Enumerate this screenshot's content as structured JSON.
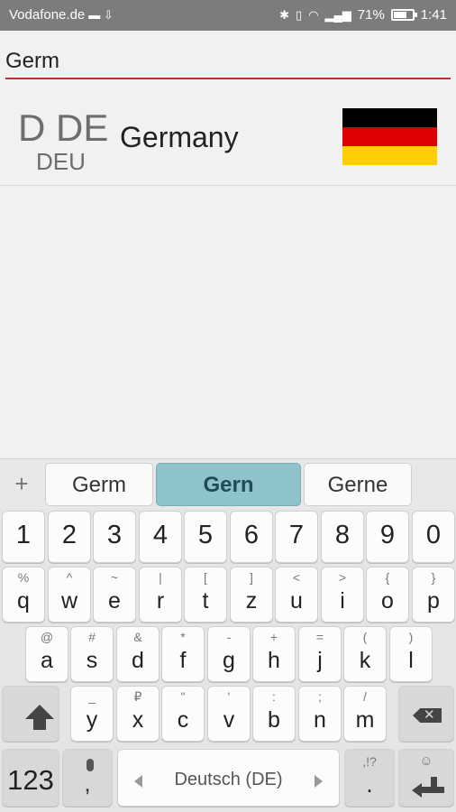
{
  "status_bar": {
    "carrier": "Vodafone.de",
    "battery_percent": "71%",
    "battery_level": 0.71,
    "time": "1:41",
    "icons": [
      "bluetooth-icon",
      "vibrate-icon",
      "wifi-icon",
      "signal-icon",
      "battery-icon",
      "usb-icon"
    ]
  },
  "search": {
    "value": "Germ",
    "accent_color": "#c9302c"
  },
  "result": {
    "code2a": "D",
    "code2b": "DE",
    "code3": "DEU",
    "country": "Germany",
    "flag_colors": [
      "#000000",
      "#dd0000",
      "#ffce00"
    ]
  },
  "keyboard": {
    "plus": "+",
    "suggestions": [
      "Germ",
      "Gern",
      "Gerne"
    ],
    "numbers": [
      "1",
      "2",
      "3",
      "4",
      "5",
      "6",
      "7",
      "8",
      "9",
      "0"
    ],
    "row1": [
      {
        "main": "q",
        "sec": "%"
      },
      {
        "main": "w",
        "sec": "^"
      },
      {
        "main": "e",
        "sec": "~"
      },
      {
        "main": "r",
        "sec": "|"
      },
      {
        "main": "t",
        "sec": "["
      },
      {
        "main": "z",
        "sec": "]"
      },
      {
        "main": "u",
        "sec": "<"
      },
      {
        "main": "i",
        "sec": ">"
      },
      {
        "main": "o",
        "sec": "{"
      },
      {
        "main": "p",
        "sec": "}"
      }
    ],
    "row2": [
      {
        "main": "a",
        "sec": "@"
      },
      {
        "main": "s",
        "sec": "#"
      },
      {
        "main": "d",
        "sec": "&"
      },
      {
        "main": "f",
        "sec": "*"
      },
      {
        "main": "g",
        "sec": "-"
      },
      {
        "main": "h",
        "sec": "+"
      },
      {
        "main": "j",
        "sec": "="
      },
      {
        "main": "k",
        "sec": "("
      },
      {
        "main": "l",
        "sec": ")"
      }
    ],
    "row3": [
      {
        "main": "y",
        "sec": "_"
      },
      {
        "main": "x",
        "sec": "₽"
      },
      {
        "main": "c",
        "sec": "\""
      },
      {
        "main": "v",
        "sec": "'"
      },
      {
        "main": "b",
        "sec": ":"
      },
      {
        "main": "n",
        "sec": ";"
      },
      {
        "main": "m",
        "sec": "/"
      }
    ],
    "numbers_key": "123",
    "comma": ",",
    "space_label": "Deutsch (DE)",
    "period": ".",
    "period_sec": ",!?",
    "emoji_sec": "☺"
  }
}
